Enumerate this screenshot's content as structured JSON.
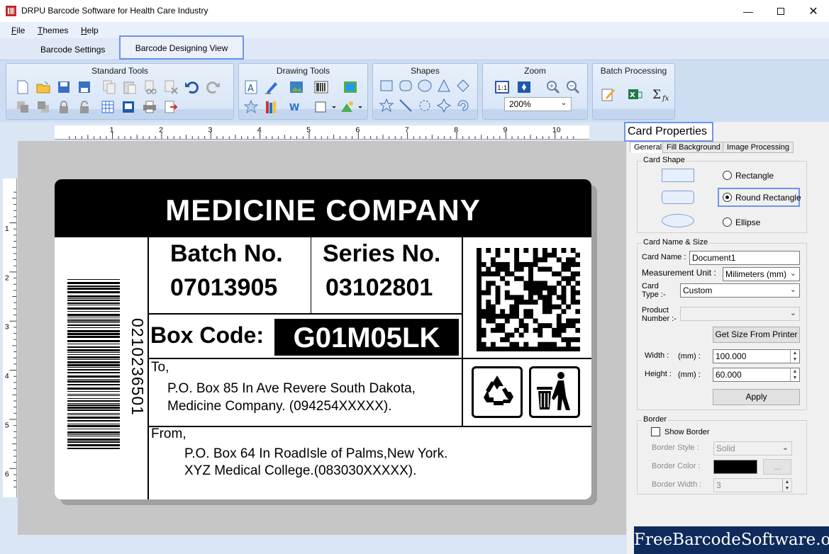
{
  "window": {
    "title": "DRPU Barcode Software for Health Care Industry"
  },
  "menu": [
    "File",
    "Themes",
    "Help"
  ],
  "ribbon_tabs": {
    "settings": "Barcode Settings",
    "designing": "Barcode Designing View"
  },
  "ribbon_groups": {
    "standard": "Standard Tools",
    "drawing": "Drawing Tools",
    "shapes": "Shapes",
    "zoom": "Zoom",
    "batch": "Batch Processing"
  },
  "zoom": {
    "value": "200%"
  },
  "ruler": {
    "h_ticks": [
      "1",
      "2",
      "3",
      "4",
      "5",
      "6",
      "7",
      "8",
      "9",
      "10"
    ],
    "v_ticks": [
      "1",
      "2",
      "3",
      "4",
      "5",
      "6"
    ]
  },
  "card": {
    "header": "MEDICINE COMPANY",
    "batch_label": "Batch No.",
    "batch_value": "07013905",
    "series_label": "Series No.",
    "series_value": "03102801",
    "boxcode_label": "Box Code:",
    "boxcode_value": "G01M05LK",
    "barcode_number": "0210236501",
    "to_label": "To,",
    "to_line1": "P.O. Box 85 In Ave Revere South Dakota,",
    "to_line2": "Medicine Company. (094254XXXXX).",
    "from_label": "From,",
    "from_line1": "P.O. Box 64 In RoadIsle of Palms,New York.",
    "from_line2": "XYZ Medical College.(083030XXXXX)."
  },
  "panel": {
    "title": "Card Properties",
    "tabs": [
      "General",
      "Fill Background",
      "Image Processing"
    ],
    "card_shape": {
      "title": "Card Shape",
      "options": [
        "Rectangle",
        "Round Rectangle",
        "Ellipse"
      ],
      "selected": "Round Rectangle"
    },
    "name_size": {
      "title": "Card  Name & Size",
      "card_name_label": "Card Name :",
      "card_name_value": "Document1",
      "unit_label": "Measurement Unit :",
      "unit_value": "Milimeters (mm)",
      "type_label1": "Card",
      "type_label2": "Type :-",
      "type_value": "Custom",
      "product_label1": "Product",
      "product_label2": "Number :-",
      "get_size_button": "Get Size From Printer",
      "width_label": "Width :",
      "width_unit": "(mm) :",
      "width_value": "100.000",
      "height_label": "Height :",
      "height_unit": "(mm) :",
      "height_value": "60.000",
      "apply_button": "Apply"
    },
    "border": {
      "title": "Border",
      "show_label": "Show Border",
      "style_label": "Border Style :",
      "style_value": "Solid",
      "color_label": "Border Color :",
      "color_value": "#000000",
      "color_button": "...",
      "width_label": "Border Width :",
      "width_value": "3"
    }
  },
  "watermark": "FreeBarcodeSoftware.org"
}
